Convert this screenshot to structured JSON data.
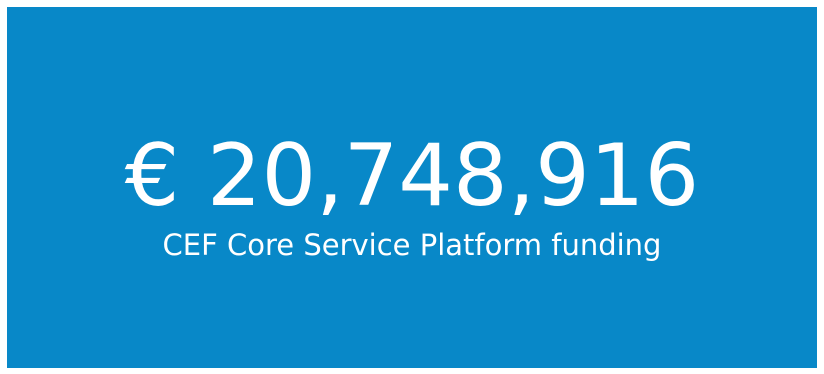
{
  "tile": {
    "background_color": "#0888c8",
    "text_color": "#ffffff",
    "amount": "€ 20,748,916",
    "label": "CEF Core Service Platform funding"
  }
}
